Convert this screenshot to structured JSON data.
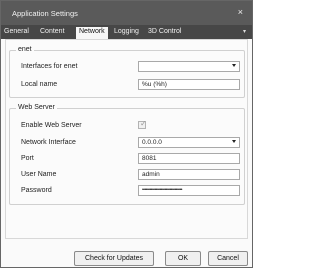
{
  "window": {
    "title": "Application Settings"
  },
  "tabs": [
    "General",
    "Content",
    "Network",
    "Logging",
    "3D Control"
  ],
  "enet": {
    "group_title": "enet",
    "interfaces_label": "Interfaces for enet",
    "interfaces_value": "",
    "local_name_label": "Local name",
    "local_name_value": "%u (%h)"
  },
  "web_server": {
    "group_title": "Web Server",
    "enable_label": "Enable Web Server",
    "enabled": true,
    "network_interface_label": "Network Interface",
    "network_interface_value": "0.0.0.0",
    "port_label": "Port",
    "port_value": "8081",
    "user_name_label": "User Name",
    "user_name_value": "admin",
    "password_label": "Password",
    "password_value": "••••••••••••••••••••••••••••••••"
  },
  "buttons": {
    "check_updates": "Check for Updates",
    "ok": "OK",
    "cancel": "Cancel"
  }
}
